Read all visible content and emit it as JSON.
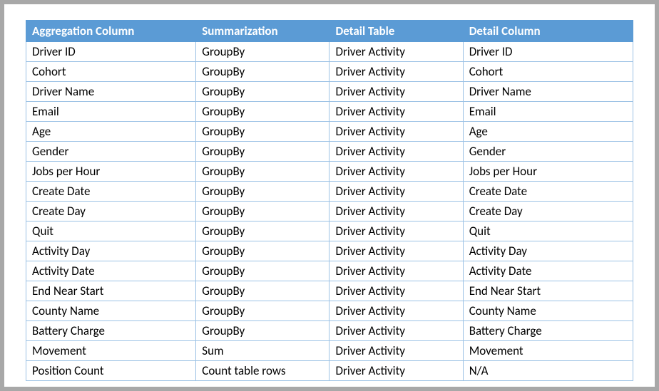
{
  "table": {
    "headers": {
      "aggregation_column": "Aggregation Column",
      "summarization": "Summarization",
      "detail_table": "Detail Table",
      "detail_column": "Detail Column"
    },
    "rows": [
      {
        "aggregation_column": "Driver ID",
        "summarization": "GroupBy",
        "detail_table": "Driver Activity",
        "detail_column": "Driver ID"
      },
      {
        "aggregation_column": "Cohort",
        "summarization": "GroupBy",
        "detail_table": "Driver Activity",
        "detail_column": "Cohort"
      },
      {
        "aggregation_column": "Driver Name",
        "summarization": "GroupBy",
        "detail_table": "Driver Activity",
        "detail_column": "Driver Name"
      },
      {
        "aggregation_column": "Email",
        "summarization": "GroupBy",
        "detail_table": "Driver Activity",
        "detail_column": "Email"
      },
      {
        "aggregation_column": "Age",
        "summarization": "GroupBy",
        "detail_table": "Driver Activity",
        "detail_column": "Age"
      },
      {
        "aggregation_column": "Gender",
        "summarization": "GroupBy",
        "detail_table": "Driver Activity",
        "detail_column": "Gender"
      },
      {
        "aggregation_column": "Jobs per Hour",
        "summarization": "GroupBy",
        "detail_table": "Driver Activity",
        "detail_column": "Jobs per Hour"
      },
      {
        "aggregation_column": "Create Date",
        "summarization": "GroupBy",
        "detail_table": "Driver Activity",
        "detail_column": "Create Date"
      },
      {
        "aggregation_column": "Create Day",
        "summarization": "GroupBy",
        "detail_table": "Driver Activity",
        "detail_column": "Create Day"
      },
      {
        "aggregation_column": "Quit",
        "summarization": "GroupBy",
        "detail_table": "Driver Activity",
        "detail_column": "Quit"
      },
      {
        "aggregation_column": "Activity Day",
        "summarization": "GroupBy",
        "detail_table": "Driver Activity",
        "detail_column": "Activity Day"
      },
      {
        "aggregation_column": "Activity Date",
        "summarization": "GroupBy",
        "detail_table": "Driver Activity",
        "detail_column": "Activity Date"
      },
      {
        "aggregation_column": "End Near Start",
        "summarization": "GroupBy",
        "detail_table": "Driver Activity",
        "detail_column": "End Near Start"
      },
      {
        "aggregation_column": "County Name",
        "summarization": "GroupBy",
        "detail_table": "Driver Activity",
        "detail_column": "County Name"
      },
      {
        "aggregation_column": "Battery Charge",
        "summarization": "GroupBy",
        "detail_table": "Driver Activity",
        "detail_column": "Battery Charge"
      },
      {
        "aggregation_column": "Movement",
        "summarization": "Sum",
        "detail_table": "Driver Activity",
        "detail_column": "Movement"
      },
      {
        "aggregation_column": "Position Count",
        "summarization": "Count table rows",
        "detail_table": "Driver Activity",
        "detail_column": "N/A"
      }
    ]
  }
}
